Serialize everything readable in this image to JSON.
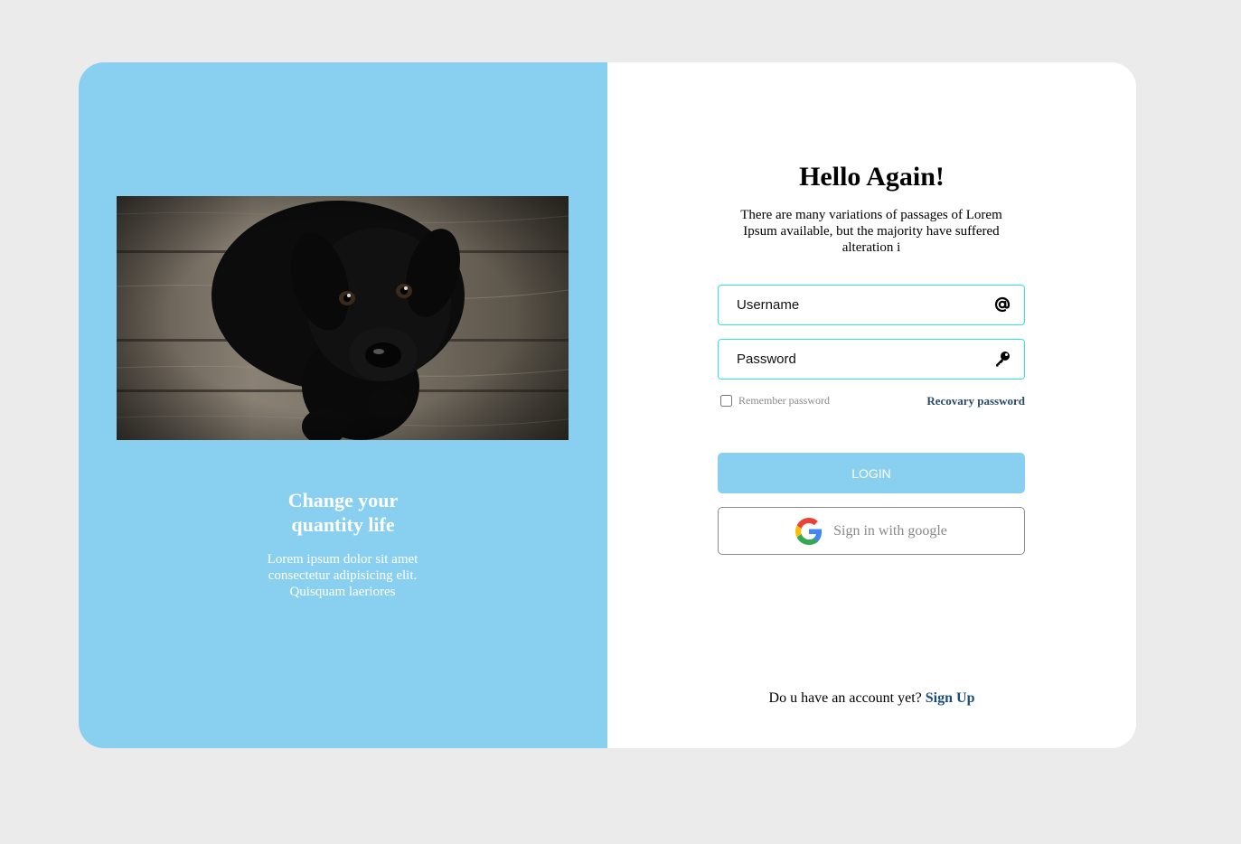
{
  "left": {
    "title_line1": "Change your",
    "title_line2": "quantity life",
    "text": "Lorem ipsum dolor sit amet consectetur adipisicing elit. Quisquam laeriores",
    "photo_alt": "black puppy on wooden floor"
  },
  "form": {
    "heading": "Hello Again!",
    "subheading": "There are many variations of passages of Lorem Ipsum available, but the majority have suffered alteration i",
    "username_placeholder": "Username",
    "password_placeholder": "Password",
    "remember_label": "Remember password",
    "recovery_label": "Recovary password",
    "login_label": "LOGIN",
    "google_label": "Sign in with google",
    "signup_prompt": "Do u have an account yet?",
    "signup_label": "Sign Up"
  },
  "icons": {
    "username": "at-icon",
    "password": "key-icon",
    "google": "google-icon"
  },
  "colors": {
    "page_background": "#ebebeb",
    "accent": "#89cff0",
    "input_border": "#2ee5e0",
    "link": "#1d4e7b"
  }
}
